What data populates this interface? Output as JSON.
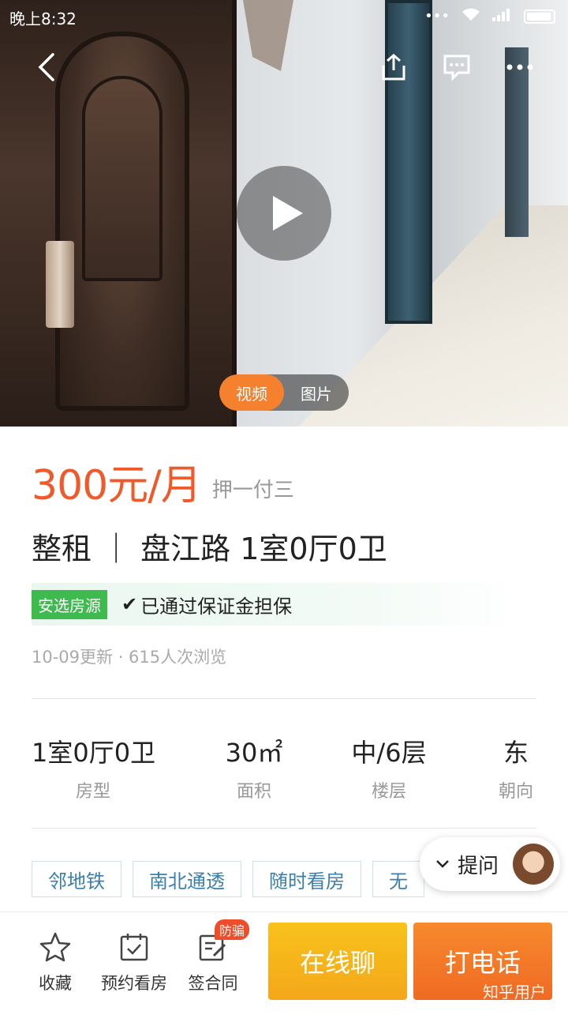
{
  "status_bar": {
    "time": "晚上8:32",
    "dots": "•••"
  },
  "hero": {
    "media_tabs": [
      {
        "label": "视频",
        "active": true
      },
      {
        "label": "图片",
        "active": false
      }
    ]
  },
  "listing": {
    "price": "300元/月",
    "deposit": "押一付三",
    "title": "整租 ｜ 盘江路 1室0厅0卫",
    "badge": "安选房源",
    "guarantee": "已通过保证金担保",
    "meta": "10-09更新 · 615人次浏览"
  },
  "specs": [
    {
      "value": "1室0厅0卫",
      "label": "房型"
    },
    {
      "value": "30㎡",
      "label": "面积"
    },
    {
      "value": "中/6层",
      "label": "楼层"
    },
    {
      "value": "东",
      "label": "朝向"
    }
  ],
  "tags": [
    "邻地铁",
    "南北通透",
    "随时看房",
    "无"
  ],
  "ask": {
    "label": "提问"
  },
  "bottom_bar": {
    "favorite": "收藏",
    "schedule": "预约看房",
    "contract": "签合同",
    "fraud_badge": "防骗",
    "chat": "在线聊",
    "call": "打电话"
  },
  "watermark": "知乎用户",
  "colors": {
    "price": "#f05a2a",
    "accent": "#f5802e",
    "chat_btn": "#f8c21b",
    "call_btn": "#f06a24",
    "badge": "#3fba4f"
  },
  "icons": [
    "back-icon",
    "share-icon",
    "message-icon",
    "more-icon",
    "play-icon",
    "check-icon",
    "star-icon",
    "calendar-icon",
    "contract-icon",
    "chevron-down-icon"
  ]
}
